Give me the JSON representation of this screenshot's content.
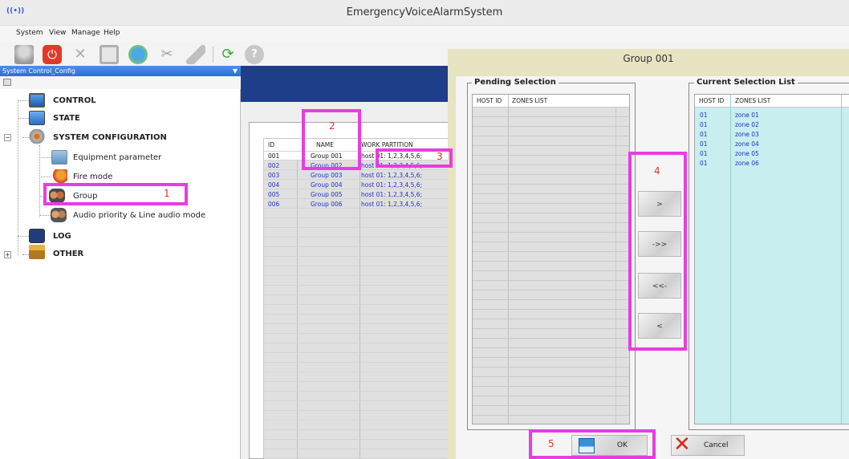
{
  "window": {
    "title": "EmergencyVoiceAlarmSystem",
    "app_icon": "((•))"
  },
  "menu": [
    "System",
    "View",
    "Manage",
    "Help"
  ],
  "toolbar_icons": [
    "user-icon",
    "power-icon",
    "tools-icon",
    "save-icon",
    "globe-refresh-icon",
    "scissors-icon",
    "eraser-icon",
    "refresh-icon",
    "help-icon"
  ],
  "left_panel": {
    "header": "System Control_Config",
    "tree": [
      {
        "label": "CONTROL",
        "icon": "monitor-icon"
      },
      {
        "label": "STATE",
        "icon": "screen-icon"
      },
      {
        "label": "SYSTEM CONFIGURATION",
        "icon": "gear-icon",
        "expander": "−"
      },
      {
        "label": "Equipment parameter",
        "icon": "equipment-icon"
      },
      {
        "label": "Fire mode",
        "icon": "fire-icon"
      },
      {
        "label": "Group",
        "icon": "group-icon"
      },
      {
        "label": "Audio priority & Line audio mode",
        "icon": "audio-priority-icon"
      },
      {
        "label": "LOG",
        "icon": "log-icon"
      },
      {
        "label": "OTHER",
        "icon": "toolbox-icon",
        "expander": "+"
      }
    ]
  },
  "group_table": {
    "columns": [
      "ID",
      "NAME",
      "WORK PARTITION"
    ],
    "rows": [
      {
        "id": "001",
        "name": "Group 001",
        "partition": "host 01: 1,2,3,4,5,6;"
      },
      {
        "id": "002",
        "name": "Group 002",
        "partition": "host 01: 1,2,3,4,5,6;"
      },
      {
        "id": "003",
        "name": "Group 003",
        "partition": "host 01: 1,2,3,4,5,6;"
      },
      {
        "id": "004",
        "name": "Group 004",
        "partition": "host 01: 1,2,3,4,5,6;"
      },
      {
        "id": "005",
        "name": "Group 005",
        "partition": "host 01: 1,2,3,4,5,6;"
      },
      {
        "id": "006",
        "name": "Group 006",
        "partition": "host 01: 1,2,3,4,5,6;"
      }
    ]
  },
  "dialog": {
    "title": "Group 001",
    "pending": {
      "legend": "Pending Selection",
      "columns": [
        "HOST ID",
        "ZONES LIST"
      ],
      "rows": []
    },
    "current": {
      "legend": "Current Selection List",
      "columns": [
        "HOST ID",
        "ZONES LIST"
      ],
      "rows": [
        {
          "host": "01",
          "zone": "zone 01"
        },
        {
          "host": "01",
          "zone": "zone 02"
        },
        {
          "host": "01",
          "zone": "zone 03"
        },
        {
          "host": "01",
          "zone": "zone 04"
        },
        {
          "host": "01",
          "zone": "zone 05"
        },
        {
          "host": "01",
          "zone": "zone 06"
        }
      ]
    },
    "move_buttons": [
      ">",
      "->>",
      "<<-",
      "<"
    ],
    "ok_label": "OK",
    "cancel_label": "Cancel"
  },
  "annotations": [
    "1",
    "2",
    "3",
    "4",
    "5"
  ],
  "colors": {
    "annotation_box": "#e83de0",
    "annotation_number": "#e0342a",
    "header_blue": "#2a6fd8",
    "dialog_frame": "#e8e3c0",
    "selected_list_bg": "#c8eef0",
    "table_text_blue": "#2030c0"
  }
}
